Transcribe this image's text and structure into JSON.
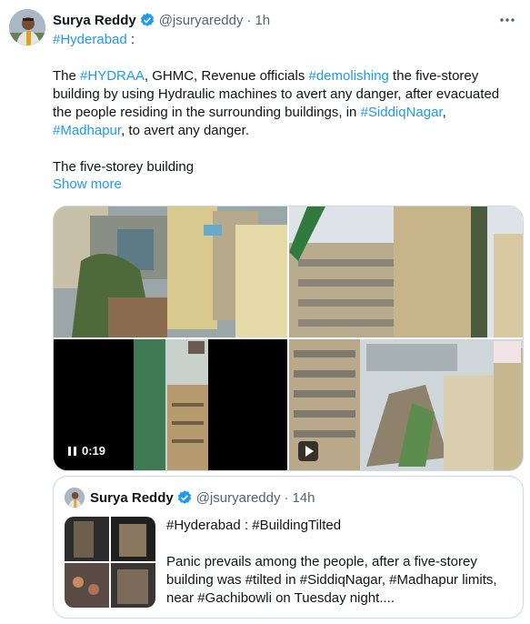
{
  "tweet": {
    "author_name": "Surya Reddy",
    "handle": "@jsuryareddy",
    "separator": "·",
    "time": "1h",
    "more_icon": "more-horizontal-icon",
    "text": {
      "line1_tag": "#Hyderabad",
      "line1_rest": " :",
      "p2_pre1": "The ",
      "p2_tag1": "#HYDRAA",
      "p2_mid1": ", GHMC, Revenue officials ",
      "p2_tag2": "#demolishing",
      "p2_mid2": " the five-storey building by using Hydraulic machines to avert any danger, after evacuated the people residing in the surrounding buildings, in ",
      "p2_tag3": "#SiddiqNagar",
      "p2_mid3": ", ",
      "p2_tag4": "#Madhapur",
      "p2_end": ", to avert any danger.",
      "p3": "The five-storey building"
    },
    "show_more": "Show more",
    "video_time": "0:19"
  },
  "quoted": {
    "author_name": "Surya Reddy",
    "handle": "@jsuryareddy",
    "separator": "·",
    "time": "14h",
    "line1": "#Hyderabad : #BuildingTilted",
    "body": "Panic prevails among the people, after a five-storey building was #tilted in #SiddiqNagar, #Madhapur limits, near #Gachibowli on Tuesday night...."
  },
  "colors": {
    "link": "#1d9bf0",
    "secondary": "#536471",
    "verified": "#1d9bf0"
  }
}
